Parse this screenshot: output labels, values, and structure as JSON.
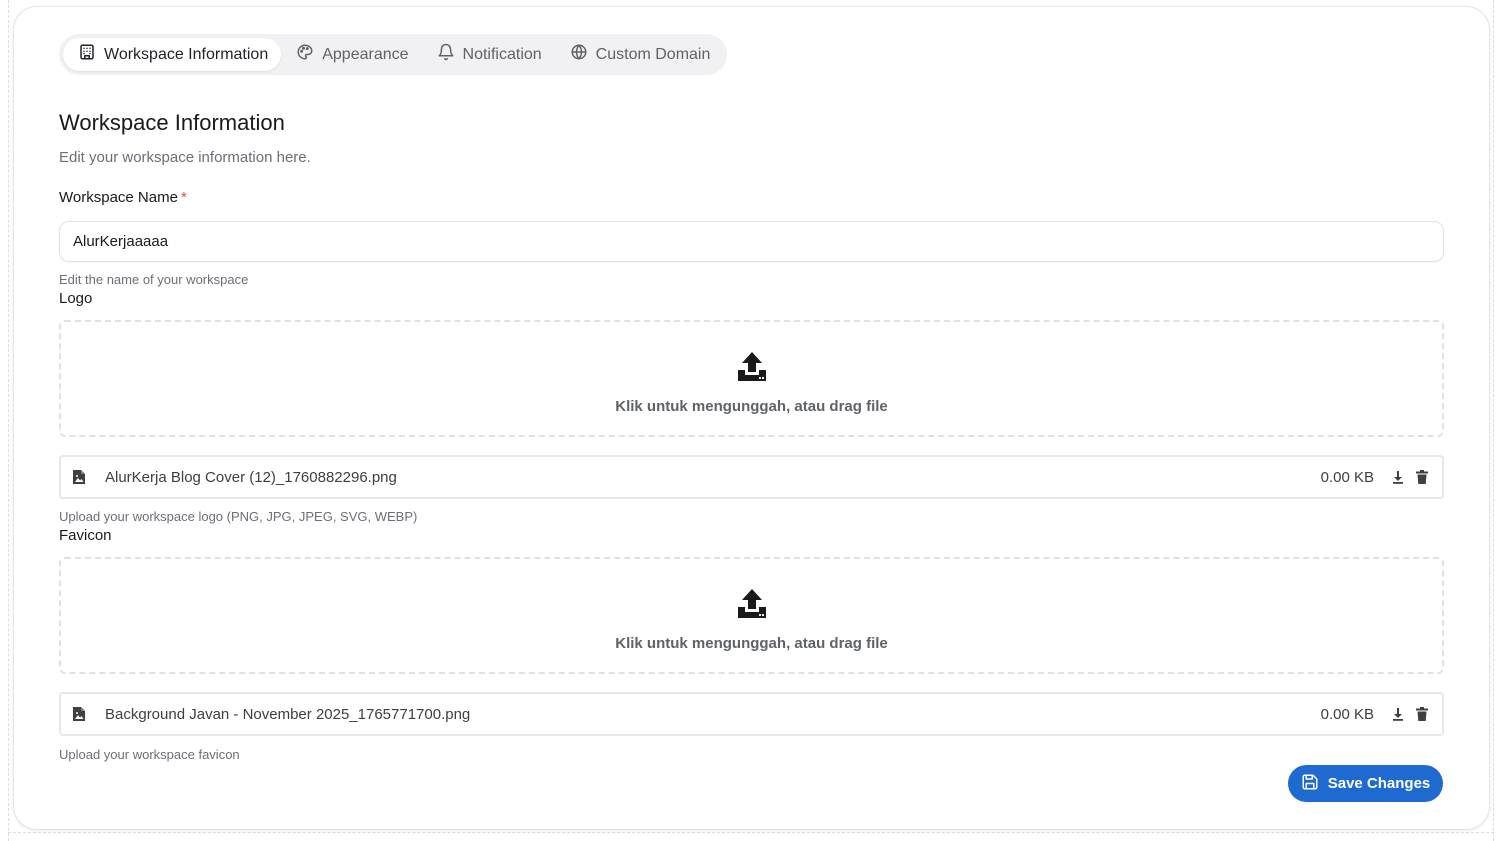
{
  "tabs": [
    {
      "label": "Workspace Information",
      "icon": "building-icon",
      "active": true
    },
    {
      "label": "Appearance",
      "icon": "palette-icon",
      "active": false
    },
    {
      "label": "Notification",
      "icon": "bell-icon",
      "active": false
    },
    {
      "label": "Custom Domain",
      "icon": "globe-icon",
      "active": false
    }
  ],
  "section": {
    "title": "Workspace Information",
    "subtitle": "Edit your workspace information here."
  },
  "workspace_name": {
    "label": "Workspace Name",
    "required_mark": "*",
    "value": "AlurKerjaaaaa",
    "helper": "Edit the name of your workspace"
  },
  "logo": {
    "label": "Logo",
    "dropzone_text": "Klik untuk mengunggah, atau drag file",
    "file_name": "AlurKerja Blog Cover (12)_1760882296.png",
    "file_size": "0.00 KB",
    "helper": "Upload your workspace logo (PNG, JPG, JPEG, SVG, WEBP)"
  },
  "favicon": {
    "label": "Favicon",
    "dropzone_text": "Klik untuk mengunggah, atau drag file",
    "file_name": "Background Javan - November 2025_1765771700.png",
    "file_size": "0.00 KB",
    "helper": "Upload your workspace favicon"
  },
  "save_button": {
    "label": "Save Changes",
    "icon": "save-icon"
  },
  "colors": {
    "accent": "#1f6ad1",
    "required": "#e5484d",
    "tab_bg": "#f1f1f3"
  }
}
